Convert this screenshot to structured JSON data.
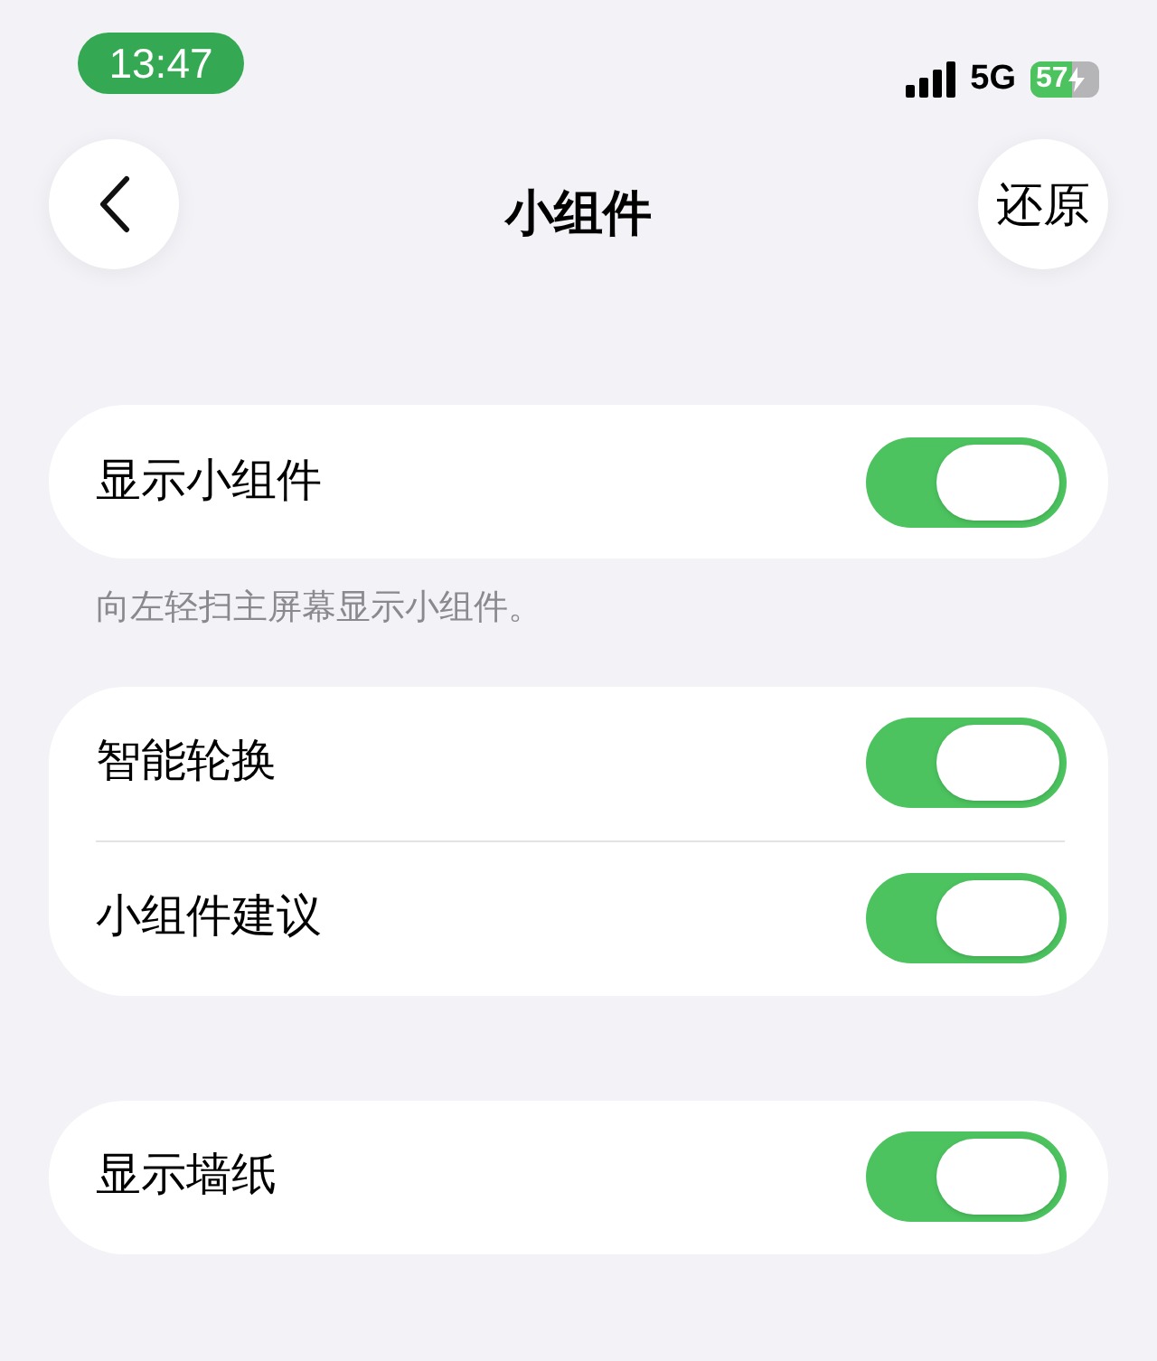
{
  "status_bar": {
    "time": "13:47",
    "network": "5G",
    "battery": "57"
  },
  "nav": {
    "title": "小组件",
    "action": "还原"
  },
  "groups": [
    {
      "rows": [
        {
          "label": "显示小组件",
          "on": true
        }
      ],
      "footer": "向左轻扫主屏幕显示小组件。"
    },
    {
      "rows": [
        {
          "label": "智能轮换",
          "on": true
        },
        {
          "label": "小组件建议",
          "on": true
        }
      ]
    },
    {
      "rows": [
        {
          "label": "显示墙纸",
          "on": true
        }
      ]
    }
  ]
}
